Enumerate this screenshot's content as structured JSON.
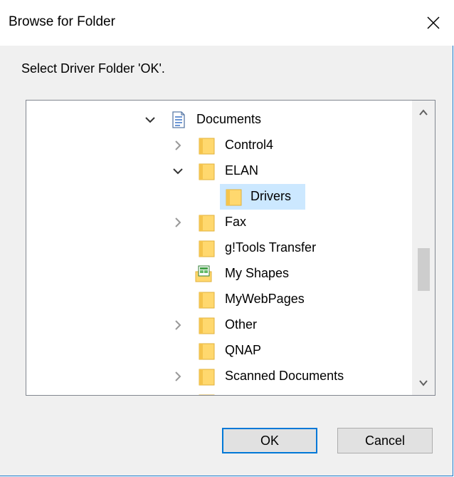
{
  "window": {
    "title": "Browse for Folder",
    "close_symbol": "✕"
  },
  "instructions": "Select Driver Folder 'OK'.",
  "tree": {
    "items": [
      {
        "label": "Documents",
        "icon": "documents-icon",
        "expander": "expanded"
      },
      {
        "label": "Control4",
        "icon": "folder-icon",
        "expander": "collapsed"
      },
      {
        "label": "ELAN",
        "icon": "folder-icon",
        "expander": "expanded"
      },
      {
        "label": "Drivers",
        "icon": "folder-icon",
        "expander": "none",
        "selected": true
      },
      {
        "label": "Fax",
        "icon": "folder-icon",
        "expander": "collapsed"
      },
      {
        "label": "g!Tools Transfer",
        "icon": "folder-icon",
        "expander": "none"
      },
      {
        "label": "My Shapes",
        "icon": "shapes-folder-icon",
        "expander": "none"
      },
      {
        "label": "MyWebPages",
        "icon": "folder-icon",
        "expander": "none"
      },
      {
        "label": "Other",
        "icon": "folder-icon",
        "expander": "collapsed"
      },
      {
        "label": "QNAP",
        "icon": "folder-icon",
        "expander": "none"
      },
      {
        "label": "Scanned Documents",
        "icon": "folder-icon",
        "expander": "collapsed"
      }
    ]
  },
  "buttons": {
    "ok": "OK",
    "cancel": "Cancel"
  },
  "colors": {
    "selection": "#cce8ff",
    "accent": "#0078d7",
    "folder": "#ffd86e"
  }
}
